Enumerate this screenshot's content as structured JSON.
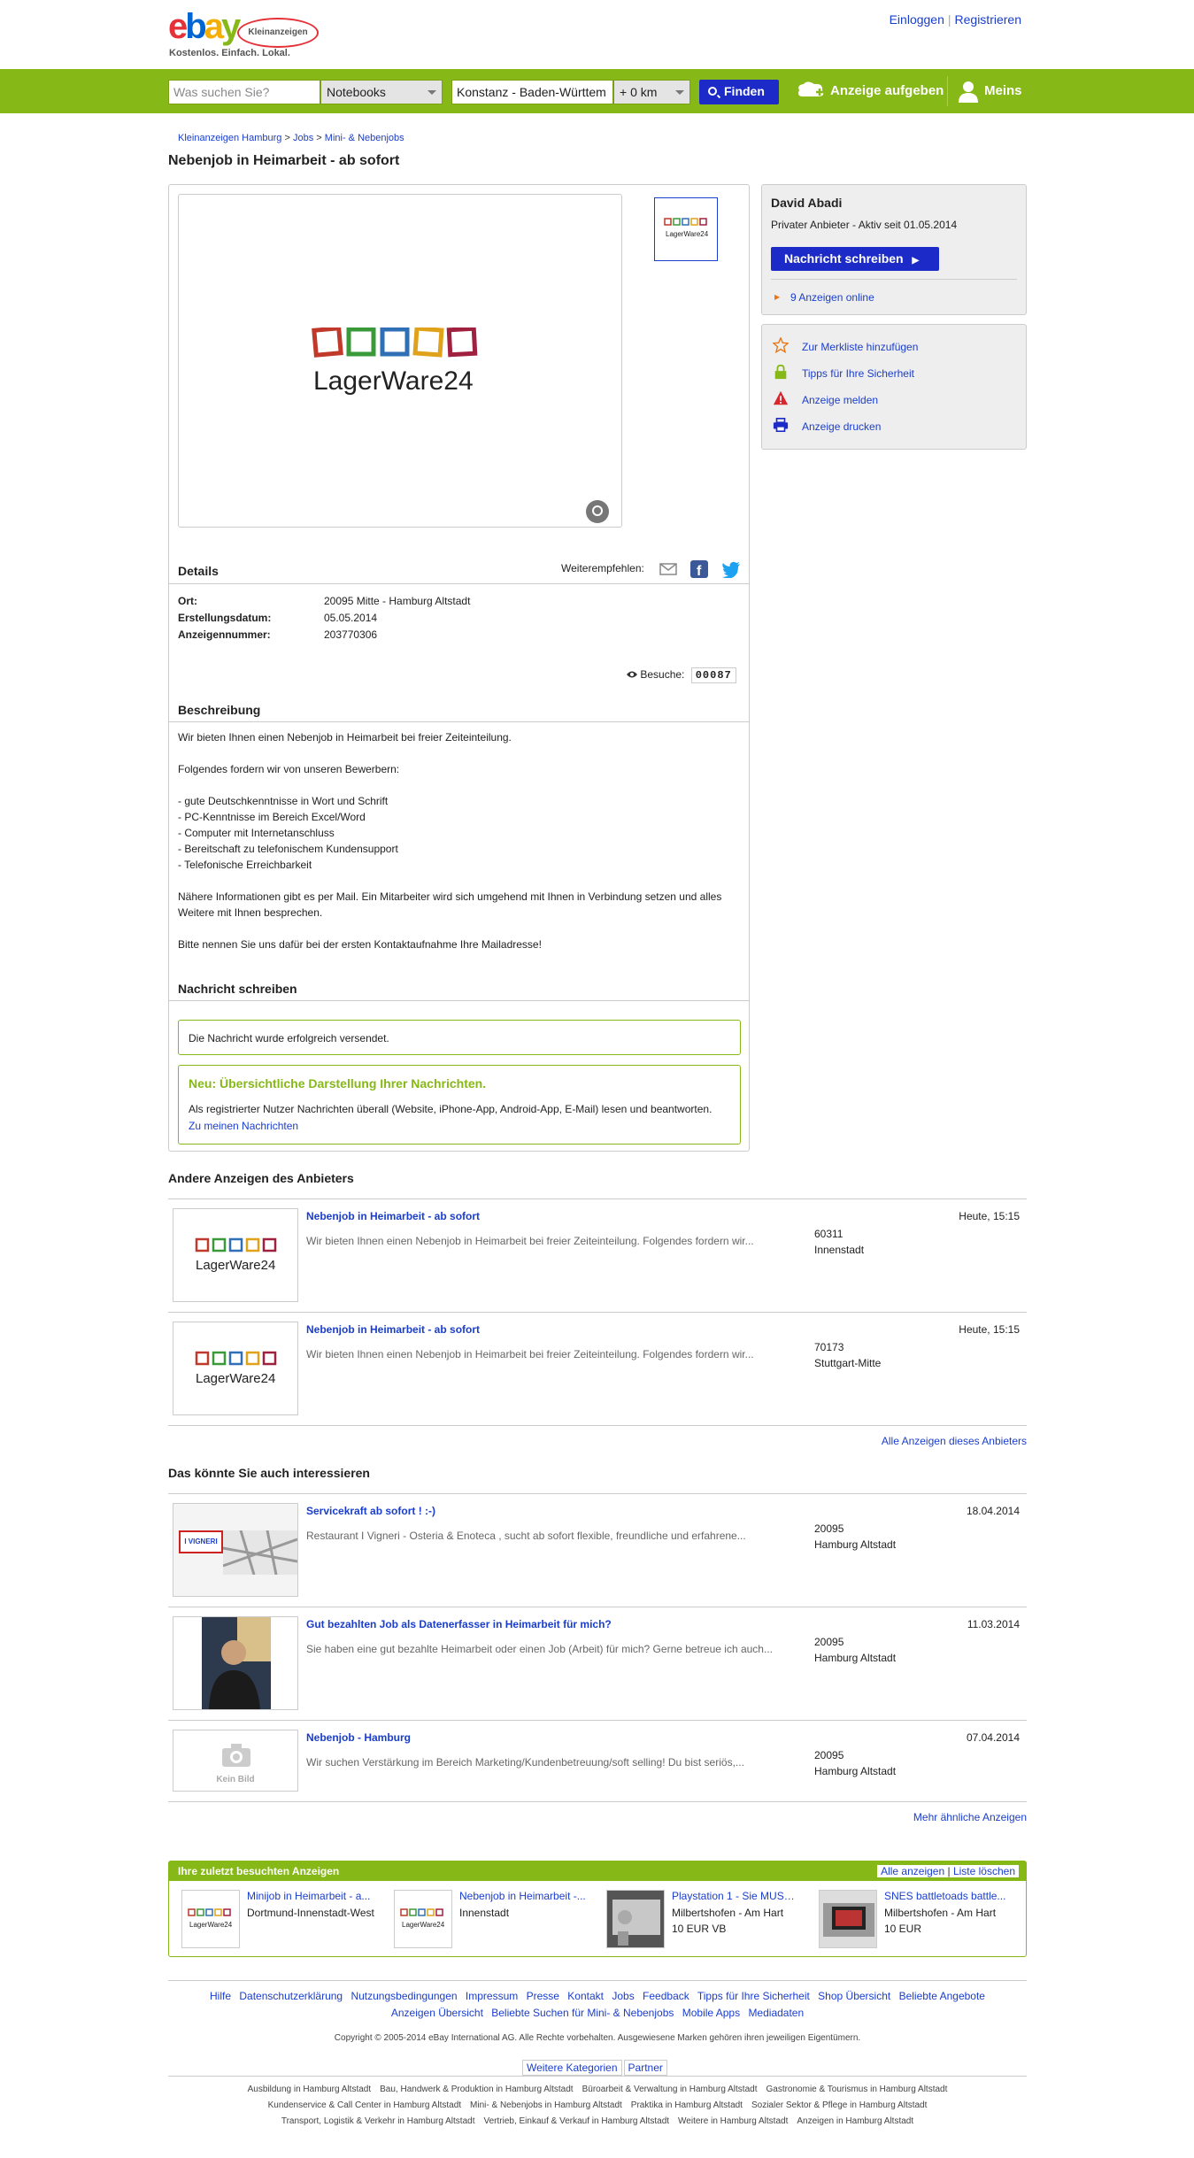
{
  "header": {
    "logo_text": "ebay",
    "logo_badge": "Kleinanzeigen",
    "tagline": "Kostenlos. Einfach. Lokal.",
    "login": "Einloggen",
    "register": "Registrieren"
  },
  "search": {
    "placeholder": "Was suchen Sie?",
    "category": "Notebooks",
    "location": "Konstanz - Baden-Württem",
    "radius": "+ 0 km",
    "find": "Finden",
    "post_ad": "Anzeige aufgeben",
    "mine": "Meins"
  },
  "breadcrumb": [
    "Kleinanzeigen Hamburg",
    ">",
    "Jobs",
    ">",
    "Mini- & Nebenjobs"
  ],
  "ad": {
    "title": "Nebenjob in Heimarbeit - ab sofort",
    "image_logo": "LagerWare24",
    "details_title": "Details",
    "share_label": "Weiterempfehlen:",
    "details": [
      {
        "label": "Ort:",
        "value": "20095 Mitte - Hamburg Altstadt"
      },
      {
        "label": "Erstellungsdatum:",
        "value": "05.05.2014"
      },
      {
        "label": "Anzeigennummer:",
        "value": "203770306"
      }
    ],
    "visits_label": "Besuche:",
    "visits": "00087",
    "desc_title": "Beschreibung",
    "description": [
      "Wir bieten Ihnen einen Nebenjob in Heimarbeit bei freier Zeiteinteilung.",
      "",
      "Folgendes fordern wir von unseren Bewerbern:",
      "",
      "- gute Deutschkenntnisse in Wort und Schrift",
      "- PC-Kenntnisse im Bereich Excel/Word",
      "- Computer mit Internetanschluss",
      "- Bereitschaft zu telefonischem Kundensupport",
      "- Telefonische Erreichbarkeit",
      "",
      "Nähere Informationen gibt es per Mail. Ein Mitarbeiter wird sich umgehend mit Ihnen in Verbindung setzen und alles Weitere mit Ihnen besprechen.",
      "",
      "Bitte nennen Sie uns dafür bei der ersten Kontaktaufnahme Ihre Mailadresse!"
    ],
    "msg_title": "Nachricht schreiben",
    "msg_sent": "Die Nachricht wurde erfolgreich versendet.",
    "msg_new_title": "Neu: Übersichtliche Darstellung Ihrer Nachrichten.",
    "msg_new_text": "Als registrierter Nutzer Nachrichten überall (Website, iPhone-App, Android-App, E-Mail) lesen und beantworten.",
    "msg_new_link": "Zu meinen Nachrichten"
  },
  "seller": {
    "name": "David Abadi",
    "since": "Privater Anbieter - Aktiv seit 01.05.2014",
    "button": "Nachricht schreiben",
    "online": "9 Anzeigen online"
  },
  "actions": [
    "Zur Merkliste hinzufügen",
    "Tipps für Ihre Sicherheit",
    "Anzeige melden",
    "Anzeige drucken"
  ],
  "other_ads": {
    "title": "Andere Anzeigen des Anbieters",
    "more": "Alle Anzeigen dieses Anbieters",
    "items": [
      {
        "title": "Nebenjob in Heimarbeit - ab sofort",
        "desc": "Wir bieten Ihnen einen Nebenjob in Heimarbeit bei freier Zeiteinteilung. Folgendes fordern wir...",
        "zip": "60311",
        "city": "Innenstadt",
        "date": "Heute, 15:15"
      },
      {
        "title": "Nebenjob in Heimarbeit - ab sofort",
        "desc": "Wir bieten Ihnen einen Nebenjob in Heimarbeit bei freier Zeiteinteilung. Folgendes fordern wir...",
        "zip": "70173",
        "city": "Stuttgart-Mitte",
        "date": "Heute, 15:15"
      }
    ]
  },
  "similar": {
    "title": "Das könnte Sie auch interessieren",
    "more": "Mehr ähnliche Anzeigen",
    "items": [
      {
        "title": "Servicekraft ab sofort ! :-)",
        "desc": "Restaurant I Vigneri - Osteria & Enoteca , sucht ab sofort flexible, freundliche und erfahrene...",
        "zip": "20095",
        "city": "Hamburg Altstadt",
        "date": "18.04.2014",
        "img_text": "I VIGNERI"
      },
      {
        "title": "Gut bezahlten Job als Datenerfasser in Heimarbeit für mich?",
        "desc": "Sie haben eine gut bezahlte Heimarbeit oder einen Job (Arbeit) für mich? Gerne betreue ich auch...",
        "zip": "20095",
        "city": "Hamburg Altstadt",
        "date": "11.03.2014"
      },
      {
        "title": "Nebenjob - Hamburg",
        "desc": "Wir suchen Verstärkung im Bereich Marketing/Kundenbetreuung/soft selling! Du bist seriös,...",
        "zip": "20095",
        "city": "Hamburg Altstadt",
        "date": "07.04.2014",
        "noimg": "Kein Bild"
      }
    ]
  },
  "recent": {
    "title": "Ihre zuletzt besuchten Anzeigen",
    "all": "Alle anzeigen",
    "clear": "Liste löschen",
    "items": [
      {
        "title": "Minijob in Heimarbeit - a...",
        "line2": "Dortmund-Innenstadt-West",
        "line3": ""
      },
      {
        "title": "Nebenjob in Heimarbeit -...",
        "line2": "Innenstadt",
        "line3": ""
      },
      {
        "title": "Playstation 1 - Sie MUSS ...",
        "line2": "Milbertshofen - Am Hart",
        "line3": "10 EUR VB"
      },
      {
        "title": "SNES battletoads battle...",
        "line2": "Milbertshofen - Am Hart",
        "line3": "10 EUR"
      }
    ]
  },
  "footer": {
    "row1": [
      "Hilfe",
      "Datenschutzerklärung",
      "Nutzungsbedingungen",
      "Impressum",
      "Presse",
      "Kontakt",
      "Jobs",
      "Feedback",
      "Tipps für Ihre Sicherheit",
      "Shop Übersicht",
      "Beliebte Angebote"
    ],
    "row2": [
      "Anzeigen Übersicht",
      "Beliebte Suchen für Mini- & Nebenjobs",
      "Mobile Apps",
      "Mediadaten"
    ],
    "copyright": "Copyright © 2005-2014 eBay International AG. Alle Rechte vorbehalten. Ausgewiesene Marken gehören ihren jeweiligen Eigentümern.",
    "tab1": "Weitere Kategorien",
    "tab2": "Partner",
    "seo1": [
      "Ausbildung in Hamburg Altstadt",
      "Bau, Handwerk & Produktion in Hamburg Altstadt",
      "Büroarbeit & Verwaltung in Hamburg Altstadt",
      "Gastronomie & Tourismus in Hamburg Altstadt"
    ],
    "seo2": [
      "Kundenservice & Call Center in Hamburg Altstadt",
      "Mini- & Nebenjobs in Hamburg Altstadt",
      "Praktika in Hamburg Altstadt",
      "Sozialer Sektor & Pflege in Hamburg Altstadt"
    ],
    "seo3": [
      "Transport, Logistik & Verkehr in Hamburg Altstadt",
      "Vertrieb, Einkauf & Verkauf in Hamburg Altstadt",
      "Weitere in Hamburg Altstadt",
      "Anzeigen in Hamburg Altstadt"
    ]
  }
}
